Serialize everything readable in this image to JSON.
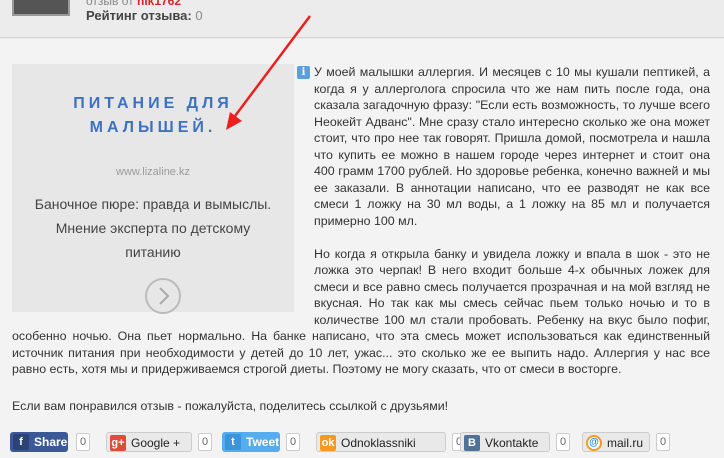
{
  "header": {
    "author_prefix": "отзыв от",
    "author_nick": "nik1762",
    "rating_label": "Рейтинг отзыва:",
    "rating_value": "0"
  },
  "ad": {
    "title_line1": "ПИТАНИЕ ДЛЯ",
    "title_line2": "МАЛЫШЕЙ.",
    "site": "www.lizaline.kz",
    "description": "Баночное пюре: правда и вымыслы. Мнение эксперта по детскому питанию",
    "info_icon": "info-icon",
    "next_icon": "chevron-right-icon"
  },
  "review": {
    "paragraph1": "У моей малышки аллергия. И месяцев с 10 мы кушали пептикей, а когда я у аллерголога спросила что же нам пить после года, она сказала загадочную фразу: \"Если есть возможность, то лучше всего Неокейт Адванс\". Мне сразу стало интересно сколько же она может стоит, что про нее так говорят. Пришла домой, посмотрела и нашла что купить ее можно в нашем городе через интернет и стоит она 400 грамм 1700 рублей. Но здоровье ребенка, конечно важней и мы ее заказали. В аннотации написано, что ее разводят не как все смеси 1 ложку на 30 мл воды, а 1 ложку на 85 мл и получается примерно 100 мл.",
    "paragraph2": "Но когда я открыла банку и увидела ложку и впала в шок - это не ложка это черпак! В него входит больше 4-х обычных ложек для смеси и все равно смесь получается прозрачная и на мой взгляд не вкусная. Но так как мы смесь сейчас пьем только ночью и то в количестве 100 мл стали пробовать. Ребенку на вкус было пофиг, особенно ночью. Она пьет нормально. На банке написано, что эта смесь может использоваться как единственный источник питания при необходимости у детей до 10 лет, ужас... это сколько же ее выпить надо. Аллергия у нас все равно есть, хотя мы и придерживаемся строгой диеты. Поэтому не могу сказать, что от смеси в восторге."
  },
  "share": {
    "prompt": "Если вам понравился отзыв - пожалуйста, поделитесь ссылкой с друзьями!",
    "buttons": [
      {
        "label": "Share",
        "count": "0",
        "icon": "f"
      },
      {
        "label": "Google +",
        "count": "0",
        "icon": "g+"
      },
      {
        "label": "Tweet",
        "count": "0",
        "icon": "t"
      },
      {
        "label": "Odnoklassniki",
        "count": "0",
        "icon": "ok"
      },
      {
        "label": "Vkontakte",
        "count": "0",
        "icon": "B"
      },
      {
        "label": "mail.ru",
        "count": "0",
        "icon": "@"
      }
    ]
  },
  "colors": {
    "accent_blue": "#3d71c2",
    "arrow_red": "#e8211f",
    "nick_red": "#d3262b"
  }
}
